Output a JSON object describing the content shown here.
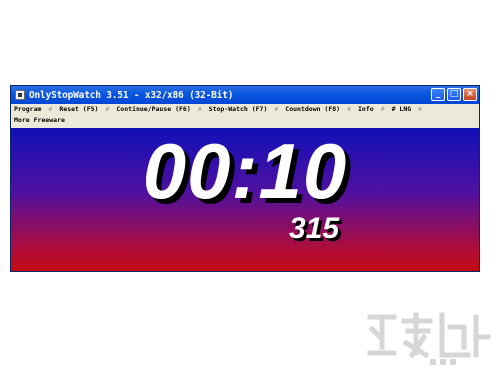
{
  "window": {
    "title": "OnlyStopWatch 3.51 - x32/x86 (32-Bit)",
    "controls": {
      "minimize": "_",
      "maximize": "□",
      "close": "×"
    }
  },
  "menu": {
    "separator": "#",
    "row1": [
      "Program",
      "Reset  (F5)",
      "Continue/Pause (F6)",
      "Stop-Watch  (F7)",
      "Countdown  (F8)",
      "Info",
      "# LNG"
    ],
    "row2": [
      "More Freeware"
    ]
  },
  "display": {
    "time": "00:10",
    "milliseconds": "315"
  },
  "colors": {
    "gradient_top": "#1010b8",
    "gradient_bottom": "#c40a10",
    "titlebar": "#0a58e0"
  }
}
